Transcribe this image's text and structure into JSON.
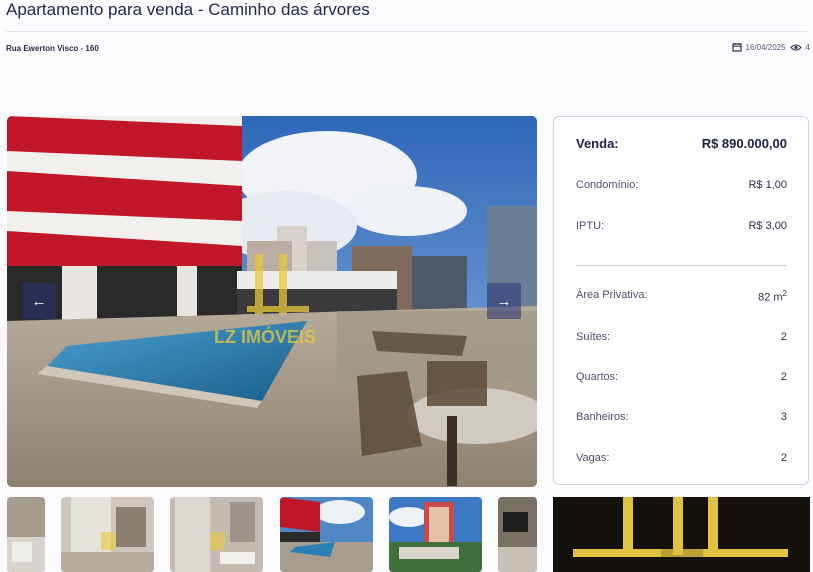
{
  "listing": {
    "title": "Apartamento para venda - Caminho das árvores",
    "address": "Rua Ewerton Visco - 160",
    "date": "16/04/2025",
    "views": "4"
  },
  "gallery": {
    "prev_label": "←",
    "next_label": "→",
    "watermark": "LZ IMÓVEIS"
  },
  "details": {
    "sale_label": "Venda:",
    "sale_value": "R$ 890.000,00",
    "condo_label": "Condomínio:",
    "condo_value": "R$ 1,00",
    "iptu_label": "IPTU:",
    "iptu_value": "R$ 3,00",
    "area_label": "Área Privativa:",
    "area_value": "82 m",
    "area_unit_sup": "2",
    "suites_label": "Suítes:",
    "suites_value": "2",
    "rooms_label": "Quartos:",
    "rooms_value": "2",
    "bath_label": "Banheiros:",
    "bath_value": "3",
    "parking_label": "Vagas:",
    "parking_value": "2"
  },
  "colors": {
    "title": "#24274a",
    "card_border": "#cfd1dd",
    "building_red": "#c0172a",
    "watermark": "#e9c93a"
  },
  "icons": [
    "calendar-icon",
    "eye-icon",
    "arrow-left-icon",
    "arrow-right-icon"
  ]
}
